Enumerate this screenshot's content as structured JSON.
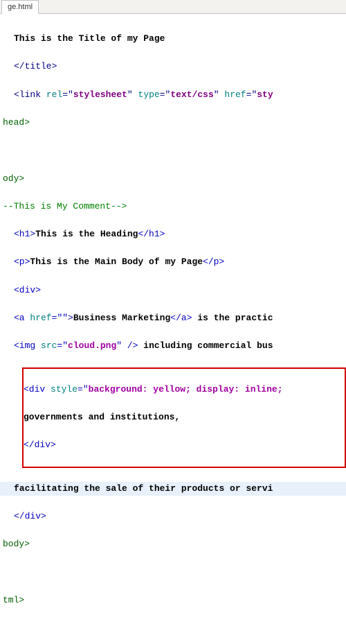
{
  "tab": {
    "name": "ge.html"
  },
  "code": {
    "titleText": "This is the Title of my Page",
    "closeTitle": "</title>",
    "link1": "<",
    "linkN": "link",
    "relKey": "rel",
    "relVal": "stylesheet",
    "typeKey": "type",
    "typeVal": "text/css",
    "hrefKey": "href",
    "hrefVal": "sty",
    "headClose": "head>",
    "bodyOpen": "ody>",
    "comment": "--This is My Comment-->",
    "h1Open": "<h1>",
    "h1Text": "This is the Heading",
    "h1Close": "</h1>",
    "pOpen": "<p>",
    "pText": "This is the Main Body of my Page",
    "pClose": "</p>",
    "divOpen": "<div>",
    "aOpen1": "<a ",
    "aHrefKey": "href",
    "aHrefVal": "\"\"",
    "aOpen2": ">",
    "aText": "Business Marketing",
    "aClose": "</a>",
    "afterA": " is the practic",
    "imgOpen": "<img ",
    "srcKey": "src",
    "srcVal": "cloud.png",
    "imgClose": " />",
    "afterImg": " including commercial bus",
    "redDivOpen": "<div ",
    "styleKey": "style",
    "styleVal": "background: yellow; display: inline;",
    "redLine2": "governments and institutions,",
    "redClose": "</div>",
    "hlText": "facilitating the sale of their products or servi",
    "divClose": "</div>",
    "bodyClose": "body>",
    "htmlClose": "tml>"
  }
}
